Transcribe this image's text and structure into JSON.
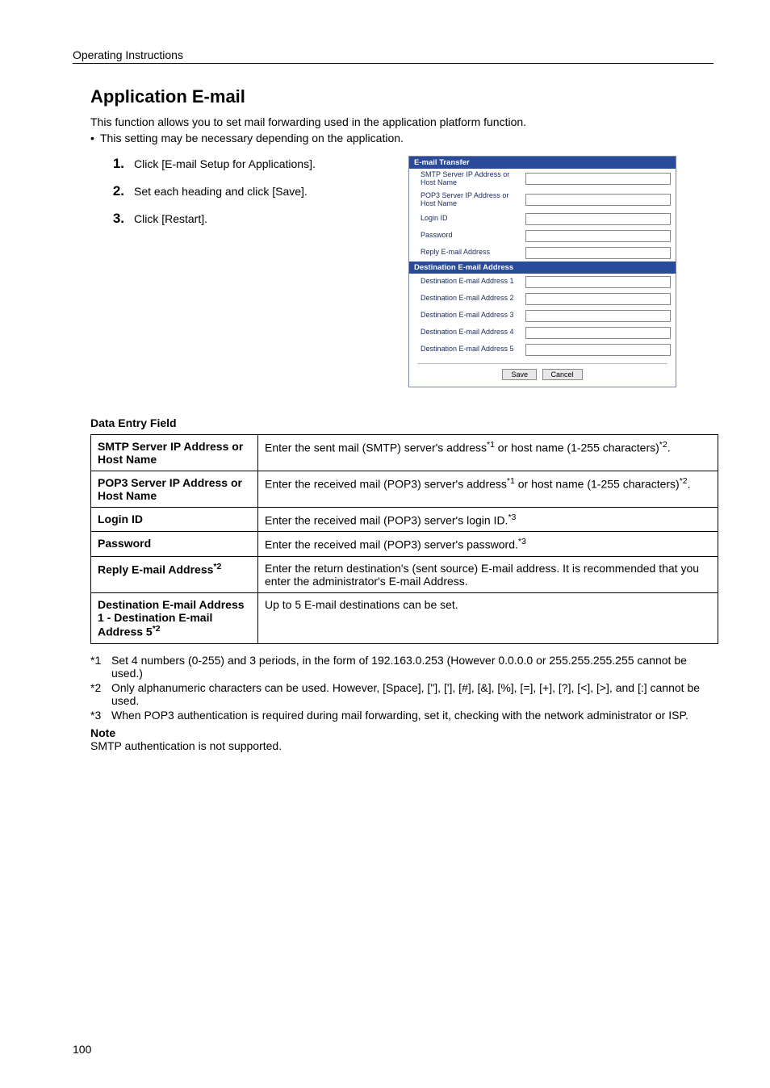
{
  "header": {
    "title": "Operating Instructions"
  },
  "section": {
    "title": "Application E-mail",
    "intro": "This function allows you to set mail forwarding used in the application platform function.",
    "bullet": "This setting may be necessary depending on the application."
  },
  "steps": [
    {
      "num": "1.",
      "text": "Click [E-mail Setup for Applications]."
    },
    {
      "num": "2.",
      "text": "Set each heading and click [Save]."
    },
    {
      "num": "3.",
      "text": "Click [Restart]."
    }
  ],
  "panel": {
    "header1": "E-mail Transfer",
    "rows1": [
      "SMTP Server IP Address or Host Name",
      "POP3 Server IP Address or Host Name",
      "Login ID",
      "Password",
      "Reply E-mail Address"
    ],
    "header2": "Destination E-mail Address",
    "rows2": [
      "Destination E-mail Address 1",
      "Destination E-mail Address 2",
      "Destination E-mail Address 3",
      "Destination E-mail Address 4",
      "Destination E-mail Address 5"
    ],
    "save": "Save",
    "cancel": "Cancel"
  },
  "data_entry_label": "Data Entry Field",
  "table": [
    {
      "name": "SMTP Server IP Address or Host Name",
      "desc_pre": "Enter the sent mail (SMTP) server's address",
      "sup1": "*1",
      "desc_mid": " or host name (1-255 characters)",
      "sup2": "*2",
      "desc_post": "."
    },
    {
      "name": "POP3 Server IP Address or Host Name",
      "desc_pre": "Enter the received mail (POP3) server's address",
      "sup1": "*1",
      "desc_mid": " or host name (1-255 characters)",
      "sup2": "*2",
      "desc_post": "."
    },
    {
      "name": "Login ID",
      "desc_pre": "Enter the received mail (POP3) server's login ID.",
      "sup1": "*3",
      "desc_mid": "",
      "sup2": "",
      "desc_post": ""
    },
    {
      "name": "Password",
      "desc_pre": "Enter the received mail (POP3) server's password.",
      "sup1": "*3",
      "desc_mid": "",
      "sup2": "",
      "desc_post": ""
    },
    {
      "name_main": "Reply E-mail Address",
      "name_sup": "*2",
      "desc_plain": "Enter the return destination's (sent source) E-mail address. It is recommended that you enter the administrator's E-mail Address."
    },
    {
      "name_main": "Destination E-mail Address 1 - Destination E-mail Address 5",
      "name_sup": "*2",
      "desc_plain": "Up to 5 E-mail destinations can be set."
    }
  ],
  "footnotes": [
    {
      "mark": "*1",
      "text": "Set 4 numbers (0-255) and 3 periods, in the form of 192.163.0.253 (However 0.0.0.0 or 255.255.255.255 cannot be used.)"
    },
    {
      "mark": "*2",
      "text": "Only alphanumeric characters can be used. However, [Space], [\"], ['], [#], [&], [%], [=], [+], [?], [<], [>], and [:] cannot be used."
    },
    {
      "mark": "*3",
      "text": "When POP3 authentication is required during mail forwarding, set it, checking with the network administrator or ISP."
    }
  ],
  "note": {
    "head": "Note",
    "text": "SMTP authentication is not supported."
  },
  "page_number": "100"
}
